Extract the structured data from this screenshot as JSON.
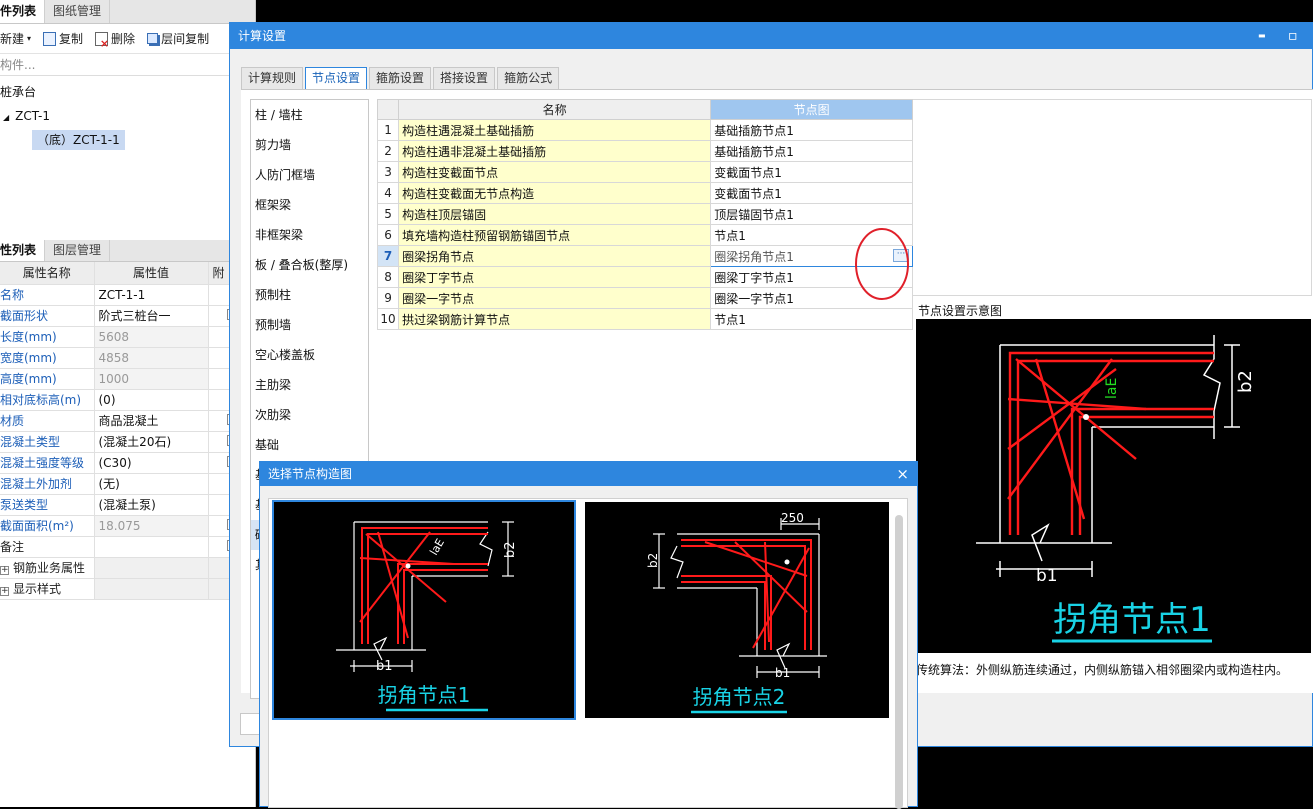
{
  "left": {
    "top_tabs": [
      "件列表",
      "图纸管理"
    ],
    "toolbar": {
      "new": "新建",
      "copy": "复制",
      "delete": "删除",
      "layer_copy": "层间复制"
    },
    "search_placeholder": "构件...",
    "tree": [
      {
        "label": "桩承台",
        "indent": 0
      },
      {
        "label": "ZCT-1",
        "indent": 1,
        "expander": "◢"
      },
      {
        "label": "（底）ZCT-1-1",
        "indent": 2,
        "selected": true
      }
    ],
    "bottom_tabs": [
      "性列表",
      "图层管理"
    ],
    "props_header": {
      "name": "属性名称",
      "value": "属性值",
      "extra": "附"
    },
    "props": [
      {
        "name": "名称",
        "value": "ZCT-1-1",
        "check": false,
        "blue": true
      },
      {
        "name": "截面形状",
        "value": "阶式三桩台一",
        "check": true,
        "blue": true
      },
      {
        "name": "长度(mm)",
        "value": "5608",
        "check": false,
        "blue": true,
        "grey": true
      },
      {
        "name": "宽度(mm)",
        "value": "4858",
        "check": false,
        "blue": true,
        "grey": true
      },
      {
        "name": "高度(mm)",
        "value": "1000",
        "check": false,
        "blue": true,
        "grey": true
      },
      {
        "name": "相对底标高(m)",
        "value": "(0)",
        "check": false,
        "blue": true
      },
      {
        "name": "材质",
        "value": "商品混凝土",
        "check": true,
        "blue": true
      },
      {
        "name": "混凝土类型",
        "value": "(混凝土20石)",
        "check": true,
        "blue": true
      },
      {
        "name": "混凝土强度等级",
        "value": "(C30)",
        "check": true,
        "blue": true
      },
      {
        "name": "混凝土外加剂",
        "value": "(无)",
        "check": false,
        "blue": true
      },
      {
        "name": "泵送类型",
        "value": "(混凝土泵)",
        "check": false,
        "blue": true
      },
      {
        "name": "截面面积(m²)",
        "value": "18.075",
        "check": true,
        "blue": true,
        "grey": true
      },
      {
        "name": "备注",
        "value": "",
        "check": true,
        "blue": false
      },
      {
        "name": "钢筋业务属性",
        "value": "",
        "check": false,
        "blue": false,
        "group": true
      },
      {
        "name": "显示样式",
        "value": "",
        "check": false,
        "blue": false,
        "group": true
      }
    ]
  },
  "dialog": {
    "title": "计算设置",
    "minimize": "▬",
    "maximize": "▫",
    "tabs": [
      "计算规则",
      "节点设置",
      "箍筋设置",
      "搭接设置",
      "箍筋公式"
    ],
    "active_tab": 1,
    "categories": [
      "柱 / 墙柱",
      "剪力墙",
      "人防门框墙",
      "框架梁",
      "非框架梁",
      "板 / 叠合板(整厚)",
      "预制柱",
      "预制墙",
      "空心楼盖板",
      "主肋梁",
      "次肋梁",
      "基础",
      "基",
      "基",
      "砌",
      "其"
    ],
    "selected_category": 14,
    "table_header": {
      "name": "名称",
      "node": "节点图"
    },
    "rows": [
      {
        "no": "1",
        "name": "构造柱遇混凝土基础插筋",
        "node": "基础插筋节点1"
      },
      {
        "no": "2",
        "name": "构造柱遇非混凝土基础插筋",
        "node": "基础插筋节点1"
      },
      {
        "no": "3",
        "name": "构造柱变截面节点",
        "node": "变截面节点1"
      },
      {
        "no": "4",
        "name": "构造柱变截面无节点构造",
        "node": "变截面节点1"
      },
      {
        "no": "5",
        "name": "构造柱顶层锚固",
        "node": "顶层锚固节点1"
      },
      {
        "no": "6",
        "name": "填充墙构造柱预留钢筋锚固节点",
        "node": "节点1"
      },
      {
        "no": "7",
        "name": "圈梁拐角节点",
        "node": "圈梁拐角节点1",
        "selected": true
      },
      {
        "no": "8",
        "name": "圈梁丁字节点",
        "node": "圈梁丁字节点1"
      },
      {
        "no": "9",
        "name": "圈梁一字节点",
        "node": "圈梁一字节点1"
      },
      {
        "no": "10",
        "name": "拱过梁钢筋计算节点",
        "node": "节点1"
      }
    ],
    "ellipsis": "···",
    "preview_label": "节点设置示意图",
    "preview_caption": "拐角节点1",
    "preview_dims": {
      "b1": "b1",
      "b2": "b2",
      "lae": "laE"
    },
    "description": "传统算法：外侧纵筋连续通过，内侧纵筋锚入相邻圈梁内或构造柱内。"
  },
  "subdialog": {
    "title": "选择节点构造图",
    "close": "×",
    "options": [
      {
        "caption": "拐角节点1",
        "dims": {
          "b1": "b1",
          "b2": "b2",
          "lae": "laE"
        },
        "selected": true
      },
      {
        "caption": "拐角节点2",
        "dims": {
          "b1": "b1",
          "b2": "b2",
          "top": "250"
        },
        "selected": false
      }
    ]
  },
  "colors": {
    "accent": "#2e86de",
    "rebar": "#ff1a1a",
    "caption": "#19d3e6",
    "highlight_ring": "#e0202a",
    "name_cell": "#ffffcc"
  }
}
